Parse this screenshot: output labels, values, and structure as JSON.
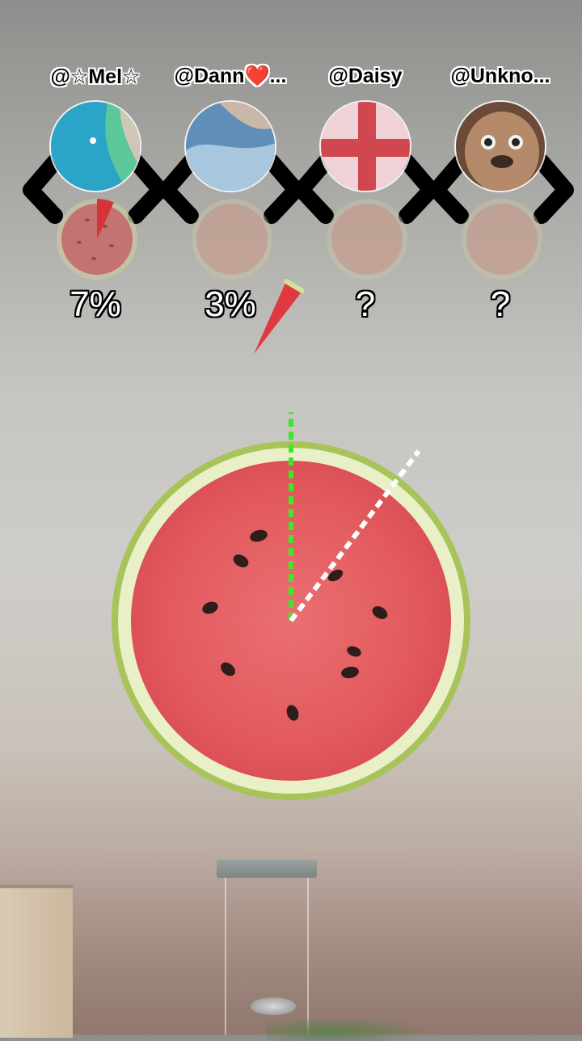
{
  "players": [
    {
      "username": "@☆Mel☆",
      "percent": "7%",
      "avatar": "sea-shore-photo",
      "slice_fraction": 0.07
    },
    {
      "username": "@Dann❤️...",
      "percent": "3%",
      "avatar": "blue-cloth-photo",
      "slice_fraction": 0.03
    },
    {
      "username": "@Daisy",
      "percent": "?",
      "avatar": "red-cross-flag-photo",
      "slice_fraction": null
    },
    {
      "username": "@Unkno...",
      "percent": "?",
      "avatar": "shaggy-dog-photo",
      "slice_fraction": null
    }
  ],
  "colors": {
    "melon_red": "#e25a5e",
    "melon_rind": "#d7e7a0",
    "guide_green": "#3fe62a",
    "guide_white": "#ffffff"
  }
}
